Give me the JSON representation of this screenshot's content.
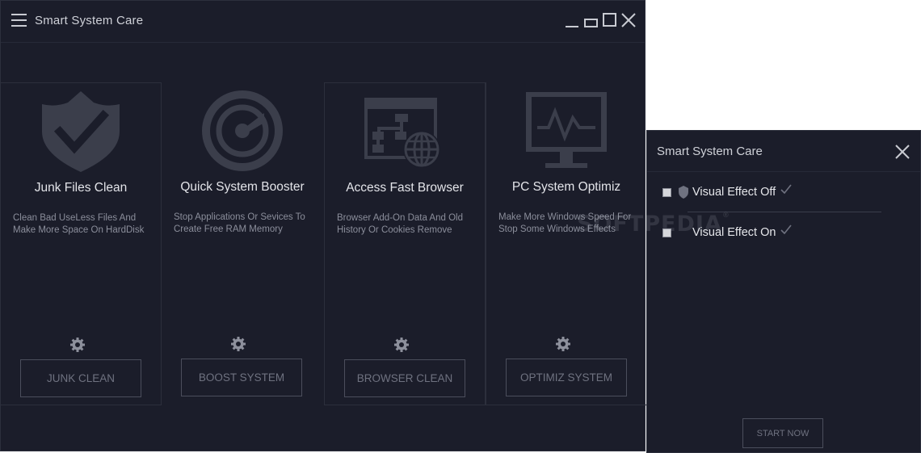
{
  "app": {
    "title": "Smart System Care"
  },
  "cards": [
    {
      "icon": "shield-check-icon",
      "title": "Junk Files Clean",
      "desc_line1": "Clean Bad UseLess Files And",
      "desc_line2": "Make More Space On HardDisk",
      "button": "JUNK CLEAN"
    },
    {
      "icon": "speed-dial-icon",
      "title": "Quick System Booster",
      "desc_line1": "Stop Applications Or Sevices To",
      "desc_line2": "Create Free RAM Memory",
      "button": "BOOST SYSTEM"
    },
    {
      "icon": "browser-network-icon",
      "title": "Access Fast Browser",
      "desc_line1": "Browser Add-On Data And Old",
      "desc_line2": "History Or Cookies Remove",
      "button": "BROWSER CLEAN"
    },
    {
      "icon": "monitor-pulse-icon",
      "title": "PC System Optimiz",
      "desc_line1": "Make More Windows Speed For",
      "desc_line2": "Stop Some Windows Effects",
      "button": "OPTIMIZ SYSTEM"
    }
  ],
  "dialog": {
    "title": "Smart System Care",
    "options": [
      {
        "label": "Visual Effect Off",
        "checked": false
      },
      {
        "label": "Visual Effect On",
        "checked": false
      }
    ],
    "start_button": "START NOW"
  },
  "watermark": {
    "text": "SOFTPEDIA",
    "mark": "®"
  },
  "colors": {
    "background": "#1b1d2a",
    "border": "#2c2f3c",
    "icon": "#3b3e4b",
    "text": "#e3e4e9",
    "muted": "#8b8e9b"
  }
}
